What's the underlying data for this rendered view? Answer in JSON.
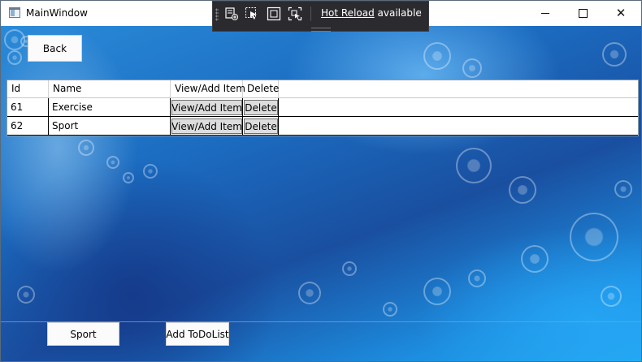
{
  "window": {
    "title": "MainWindow",
    "controls": [
      "minimize-icon",
      "maximize-icon",
      "close-icon"
    ],
    "close_glyph": "✕"
  },
  "hot_reload": {
    "link_text": "Hot Reload",
    "status_text": " available",
    "chevron": "‹",
    "icons": [
      "add-element-icon",
      "select-element-icon",
      "layout-adorner-icon",
      "track-focus-icon"
    ]
  },
  "page": {
    "back_label": "Back"
  },
  "grid": {
    "headers": {
      "id": "Id",
      "name": "Name",
      "view": "View/Add Item",
      "delete": "Delete"
    },
    "rows": [
      {
        "id": "61",
        "name": "Exercise",
        "view_label": "View/Add Item",
        "delete_label": "Delete"
      },
      {
        "id": "62",
        "name": "Sport",
        "view_label": "View/Add Item",
        "delete_label": "Delete"
      }
    ]
  },
  "footer": {
    "selected_label": "Sport",
    "add_label": "Add ToDoList"
  },
  "colors": {
    "background_accent": "#1b6bc0",
    "hot_reload_bar": "#2b2b2f",
    "button_face": "#dddddd"
  }
}
